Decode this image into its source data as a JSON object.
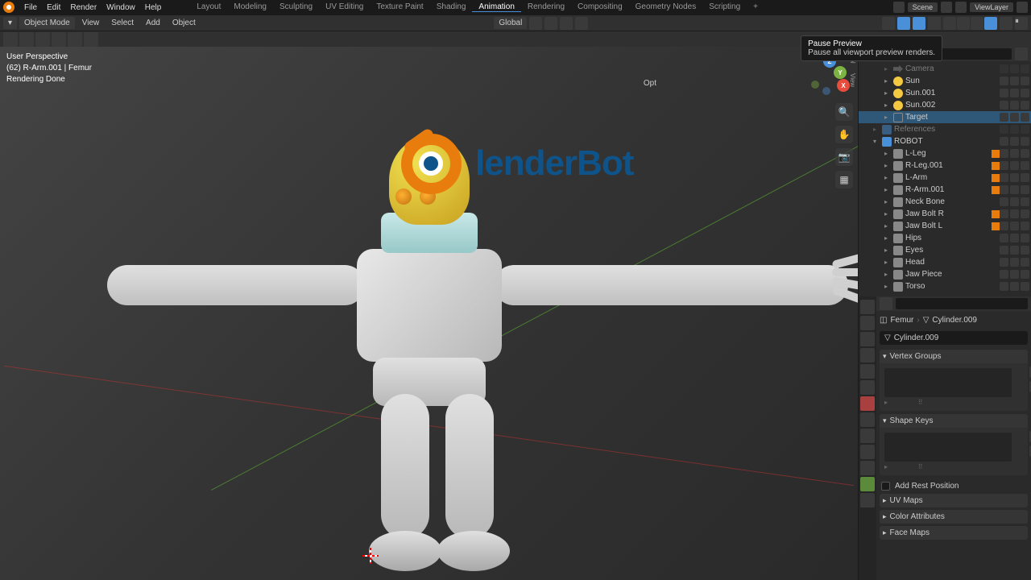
{
  "menu": {
    "file": "File",
    "edit": "Edit",
    "render": "Render",
    "window": "Window",
    "help": "Help"
  },
  "workspaces": {
    "layout": "Layout",
    "modeling": "Modeling",
    "sculpting": "Sculpting",
    "uv": "UV Editing",
    "texture": "Texture Paint",
    "shading": "Shading",
    "animation": "Animation",
    "rendering": "Rendering",
    "compositing": "Compositing",
    "geometry": "Geometry Nodes",
    "scripting": "Scripting"
  },
  "topbar": {
    "scene": "Scene",
    "viewlayer": "ViewLayer"
  },
  "header": {
    "mode": "Object Mode",
    "view": "View",
    "select": "Select",
    "add": "Add",
    "object": "Object",
    "orientation": "Global",
    "options": "Opt"
  },
  "viewport": {
    "line1": "User Perspective",
    "line2": "(62) R-Arm.001 | Femur",
    "line3": "Rendering Done",
    "tab_tool": "Tool",
    "tab_view": "View"
  },
  "tooltip": {
    "title": "Pause Preview",
    "body": "Pause all viewport preview renders."
  },
  "logo": {
    "text": "lenderBot"
  },
  "outliner": {
    "items": [
      {
        "name": "Camera",
        "depth": 2,
        "type": "cam",
        "dim": true
      },
      {
        "name": "Sun",
        "depth": 2,
        "type": "light"
      },
      {
        "name": "Sun.001",
        "depth": 2,
        "type": "light"
      },
      {
        "name": "Sun.002",
        "depth": 2,
        "type": "light"
      },
      {
        "name": "Target",
        "depth": 2,
        "type": "empty",
        "selected": true
      },
      {
        "name": "References",
        "depth": 1,
        "type": "coll",
        "dim": true
      },
      {
        "name": "ROBOT",
        "depth": 1,
        "type": "coll",
        "expanded": true
      },
      {
        "name": "L-Leg",
        "depth": 2,
        "type": "mesh",
        "mod": true
      },
      {
        "name": "R-Leg.001",
        "depth": 2,
        "type": "mesh",
        "mod": true
      },
      {
        "name": "L-Arm",
        "depth": 2,
        "type": "mesh",
        "mod": true
      },
      {
        "name": "R-Arm.001",
        "depth": 2,
        "type": "mesh",
        "mod": true
      },
      {
        "name": "Neck Bone",
        "depth": 2,
        "type": "mesh"
      },
      {
        "name": "Jaw Bolt R",
        "depth": 2,
        "type": "mesh",
        "mod": true
      },
      {
        "name": "Jaw Bolt L",
        "depth": 2,
        "type": "mesh",
        "mod": true
      },
      {
        "name": "Hips",
        "depth": 2,
        "type": "mesh"
      },
      {
        "name": "Eyes",
        "depth": 2,
        "type": "mesh"
      },
      {
        "name": "Head",
        "depth": 2,
        "type": "mesh"
      },
      {
        "name": "Jaw Piece",
        "depth": 2,
        "type": "mesh"
      },
      {
        "name": "Torso",
        "depth": 2,
        "type": "mesh"
      }
    ]
  },
  "properties": {
    "breadcrumb": {
      "obj": "Femur",
      "data": "Cylinder.009"
    },
    "datablock": "Cylinder.009",
    "sections": {
      "vertex_groups": "Vertex Groups",
      "shape_keys": "Shape Keys",
      "add_rest": "Add Rest Position",
      "uv_maps": "UV Maps",
      "color_attrs": "Color Attributes",
      "face_maps": "Face Maps"
    }
  }
}
